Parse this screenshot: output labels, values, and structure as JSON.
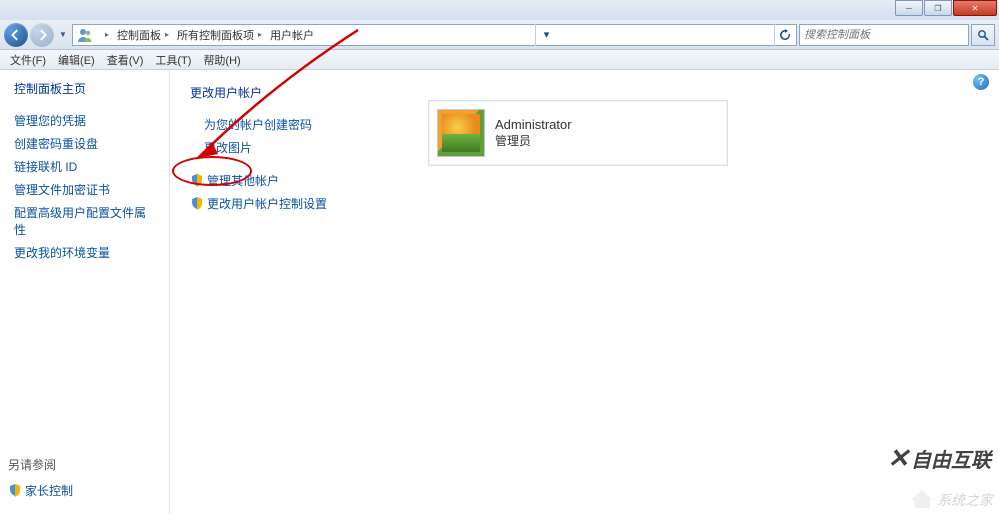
{
  "window": {
    "minimize_tip": "最小化",
    "maximize_tip": "还原",
    "close_tip": "关闭"
  },
  "breadcrumb": {
    "items": [
      "控制面板",
      "所有控制面板项",
      "用户帐户"
    ]
  },
  "search": {
    "placeholder": "搜索控制面板"
  },
  "menu": {
    "items": [
      "文件(F)",
      "编辑(E)",
      "查看(V)",
      "工具(T)",
      "帮助(H)"
    ]
  },
  "sidebar": {
    "home": "控制面板主页",
    "links": [
      "管理您的凭据",
      "创建密码重设盘",
      "链接联机 ID",
      "管理文件加密证书",
      "配置高级用户配置文件属性",
      "更改我的环境变量"
    ],
    "also": "另请参阅",
    "parental": "家长控制"
  },
  "main": {
    "title": "更改用户帐户",
    "actions": {
      "create_pwd": "为您的帐户创建密码",
      "change_pic": "更改图片",
      "manage_other": "管理其他帐户",
      "uac": "更改用户帐户控制设置"
    }
  },
  "account": {
    "name": "Administrator",
    "type": "管理员"
  },
  "watermark": {
    "w1": "自由互联",
    "w2": "系统之家"
  }
}
